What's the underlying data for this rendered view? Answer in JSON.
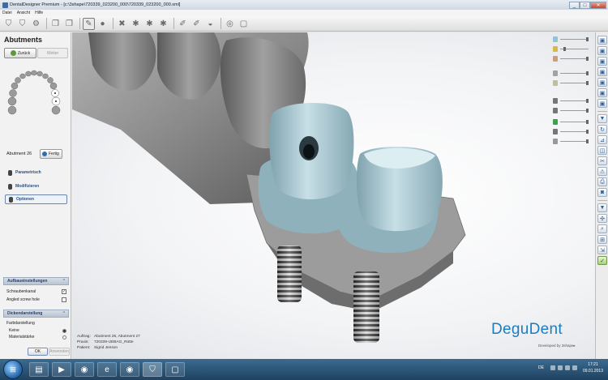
{
  "window": {
    "title": "DentalDesigner Premium - [c:\\3shape\\720339_023200_000\\720339_023200_000.xml]",
    "buttons": [
      "_",
      "□",
      "✕"
    ]
  },
  "menu": [
    "Datei",
    "Ansicht",
    "Hilfe"
  ],
  "toolbar_icons": [
    "tooth-icon",
    "tooth-group-icon",
    "gear-tooth-icon",
    "copy-icon",
    "copy-alt-icon",
    "pen-tool-icon",
    "sphere-icon",
    "wrench-icon",
    "tools-icon",
    "tools-alt-icon",
    "tools-alt2-icon",
    "brush-icon",
    "brush-alt-icon",
    "fill-icon",
    "hole-icon",
    "square-icon"
  ],
  "panel": {
    "title": "Abutments",
    "back_label": "Zurück",
    "next_label": "Weiter",
    "tooth_label": "Abutment 26",
    "done_label": "Fertig",
    "steps": [
      "Parametrisch",
      "Modifizieren",
      "Optionen"
    ],
    "build_section": {
      "title": "Aufbaueinstellungen",
      "options": [
        {
          "label": "Schraubenkanal",
          "checked": true
        },
        {
          "label": "Angled screw hole",
          "checked": false
        }
      ]
    },
    "thickness_section": {
      "title": "Dickendarstellung",
      "group_label": "Farbdarstellung",
      "options": [
        {
          "label": "Keine",
          "selected": true
        },
        {
          "label": "Materialstärke",
          "selected": false
        }
      ]
    },
    "ok_label": "OK",
    "apply_label": "Anwenden"
  },
  "info": {
    "order_key": "Auftrag:",
    "order_value": "Abutment 26, Abutment 27",
    "practice_key": "Praxis:",
    "practice_value": "720339-UEBAG_Rütte",
    "patient_key": "Patient:",
    "patient_value": "Sigrid Jenson"
  },
  "brand": {
    "name": "DeguDent",
    "tagline": "Developed by 3shape▸"
  },
  "right_toolbar_icons": [
    "view-front-icon",
    "view-back-icon",
    "view-left-icon",
    "view-right-icon",
    "view-top-icon",
    "view-bottom-icon",
    "funnel-icon",
    "rotate-icon",
    "measure-icon",
    "cross-section-icon",
    "warning-icon",
    "snapshot-icon",
    "print-icon",
    "clip-icon",
    "align-icon",
    "expand-icon",
    "zoom-icon",
    "save-icon",
    "check-icon"
  ],
  "taskbar": {
    "apps": [
      "explorer-icon",
      "media-player-icon",
      "chrome-icon",
      "internet-explorer-icon",
      "chrome-alt-icon",
      "dentaldesigner-icon",
      "window-icon"
    ],
    "language": "DE",
    "time": "17:21",
    "date": "09.01.2013"
  },
  "colors": {
    "accent": "#1b7dc1",
    "abutment": "#a9c8d2",
    "model": "#8c8c8c"
  }
}
